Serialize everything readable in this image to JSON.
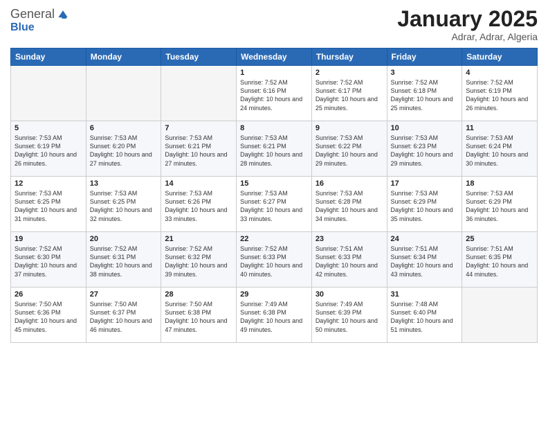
{
  "header": {
    "logo_general": "General",
    "logo_blue": "Blue",
    "month_title": "January 2025",
    "subtitle": "Adrar, Adrar, Algeria"
  },
  "weekdays": [
    "Sunday",
    "Monday",
    "Tuesday",
    "Wednesday",
    "Thursday",
    "Friday",
    "Saturday"
  ],
  "weeks": [
    [
      {
        "day": "",
        "empty": true
      },
      {
        "day": "",
        "empty": true
      },
      {
        "day": "",
        "empty": true
      },
      {
        "day": "1",
        "sunrise": "7:52 AM",
        "sunset": "6:16 PM",
        "daylight": "10 hours and 24 minutes."
      },
      {
        "day": "2",
        "sunrise": "7:52 AM",
        "sunset": "6:17 PM",
        "daylight": "10 hours and 25 minutes."
      },
      {
        "day": "3",
        "sunrise": "7:52 AM",
        "sunset": "6:18 PM",
        "daylight": "10 hours and 25 minutes."
      },
      {
        "day": "4",
        "sunrise": "7:52 AM",
        "sunset": "6:19 PM",
        "daylight": "10 hours and 26 minutes."
      }
    ],
    [
      {
        "day": "5",
        "sunrise": "7:53 AM",
        "sunset": "6:19 PM",
        "daylight": "10 hours and 26 minutes."
      },
      {
        "day": "6",
        "sunrise": "7:53 AM",
        "sunset": "6:20 PM",
        "daylight": "10 hours and 27 minutes."
      },
      {
        "day": "7",
        "sunrise": "7:53 AM",
        "sunset": "6:21 PM",
        "daylight": "10 hours and 27 minutes."
      },
      {
        "day": "8",
        "sunrise": "7:53 AM",
        "sunset": "6:21 PM",
        "daylight": "10 hours and 28 minutes."
      },
      {
        "day": "9",
        "sunrise": "7:53 AM",
        "sunset": "6:22 PM",
        "daylight": "10 hours and 29 minutes."
      },
      {
        "day": "10",
        "sunrise": "7:53 AM",
        "sunset": "6:23 PM",
        "daylight": "10 hours and 29 minutes."
      },
      {
        "day": "11",
        "sunrise": "7:53 AM",
        "sunset": "6:24 PM",
        "daylight": "10 hours and 30 minutes."
      }
    ],
    [
      {
        "day": "12",
        "sunrise": "7:53 AM",
        "sunset": "6:25 PM",
        "daylight": "10 hours and 31 minutes."
      },
      {
        "day": "13",
        "sunrise": "7:53 AM",
        "sunset": "6:25 PM",
        "daylight": "10 hours and 32 minutes."
      },
      {
        "day": "14",
        "sunrise": "7:53 AM",
        "sunset": "6:26 PM",
        "daylight": "10 hours and 33 minutes."
      },
      {
        "day": "15",
        "sunrise": "7:53 AM",
        "sunset": "6:27 PM",
        "daylight": "10 hours and 33 minutes."
      },
      {
        "day": "16",
        "sunrise": "7:53 AM",
        "sunset": "6:28 PM",
        "daylight": "10 hours and 34 minutes."
      },
      {
        "day": "17",
        "sunrise": "7:53 AM",
        "sunset": "6:29 PM",
        "daylight": "10 hours and 35 minutes."
      },
      {
        "day": "18",
        "sunrise": "7:53 AM",
        "sunset": "6:29 PM",
        "daylight": "10 hours and 36 minutes."
      }
    ],
    [
      {
        "day": "19",
        "sunrise": "7:52 AM",
        "sunset": "6:30 PM",
        "daylight": "10 hours and 37 minutes."
      },
      {
        "day": "20",
        "sunrise": "7:52 AM",
        "sunset": "6:31 PM",
        "daylight": "10 hours and 38 minutes."
      },
      {
        "day": "21",
        "sunrise": "7:52 AM",
        "sunset": "6:32 PM",
        "daylight": "10 hours and 39 minutes."
      },
      {
        "day": "22",
        "sunrise": "7:52 AM",
        "sunset": "6:33 PM",
        "daylight": "10 hours and 40 minutes."
      },
      {
        "day": "23",
        "sunrise": "7:51 AM",
        "sunset": "6:33 PM",
        "daylight": "10 hours and 42 minutes."
      },
      {
        "day": "24",
        "sunrise": "7:51 AM",
        "sunset": "6:34 PM",
        "daylight": "10 hours and 43 minutes."
      },
      {
        "day": "25",
        "sunrise": "7:51 AM",
        "sunset": "6:35 PM",
        "daylight": "10 hours and 44 minutes."
      }
    ],
    [
      {
        "day": "26",
        "sunrise": "7:50 AM",
        "sunset": "6:36 PM",
        "daylight": "10 hours and 45 minutes."
      },
      {
        "day": "27",
        "sunrise": "7:50 AM",
        "sunset": "6:37 PM",
        "daylight": "10 hours and 46 minutes."
      },
      {
        "day": "28",
        "sunrise": "7:50 AM",
        "sunset": "6:38 PM",
        "daylight": "10 hours and 47 minutes."
      },
      {
        "day": "29",
        "sunrise": "7:49 AM",
        "sunset": "6:38 PM",
        "daylight": "10 hours and 49 minutes."
      },
      {
        "day": "30",
        "sunrise": "7:49 AM",
        "sunset": "6:39 PM",
        "daylight": "10 hours and 50 minutes."
      },
      {
        "day": "31",
        "sunrise": "7:48 AM",
        "sunset": "6:40 PM",
        "daylight": "10 hours and 51 minutes."
      },
      {
        "day": "",
        "empty": true
      }
    ]
  ]
}
